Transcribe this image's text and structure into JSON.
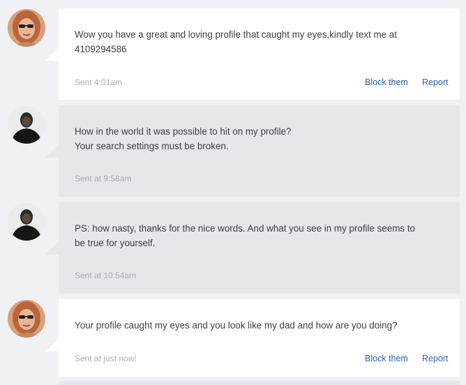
{
  "messages": [
    {
      "sender": "them",
      "text_lines": [
        "Wow you have a great and loving profile that caught my eyes,kindly text me at",
        "4109294586"
      ],
      "sent": "Sent 4:01am",
      "actions": {
        "block": "Block them",
        "report": "Report"
      }
    },
    {
      "sender": "me",
      "text_lines": [
        "How in the world it was possible to hit on my profile?",
        "Your search settings must be broken."
      ],
      "sent": "Sent at 9:58am"
    },
    {
      "sender": "me",
      "text_lines": [
        "PS: how nasty, thanks for the nice words. And what you see in my profile seems to",
        "be true for yourself."
      ],
      "sent": "Sent at 10:54am"
    },
    {
      "sender": "them",
      "text_lines": [
        "Your profile caught my eyes and you look like my dad and how are you doing?"
      ],
      "sent": "Sent at just now!",
      "actions": {
        "block": "Block them",
        "report": "Report"
      }
    }
  ],
  "colors": {
    "page_bg": "#f0f1f4",
    "incoming_bubble": "#ffffff",
    "outgoing_bubble": "#e6e7eb",
    "link": "#2e5fb8",
    "meta_text": "#a9adb6",
    "body_text": "#3b3f47"
  },
  "icons": {
    "them_avatar": "woman-sunglasses-avatar",
    "me_avatar": "man-dark-avatar"
  }
}
